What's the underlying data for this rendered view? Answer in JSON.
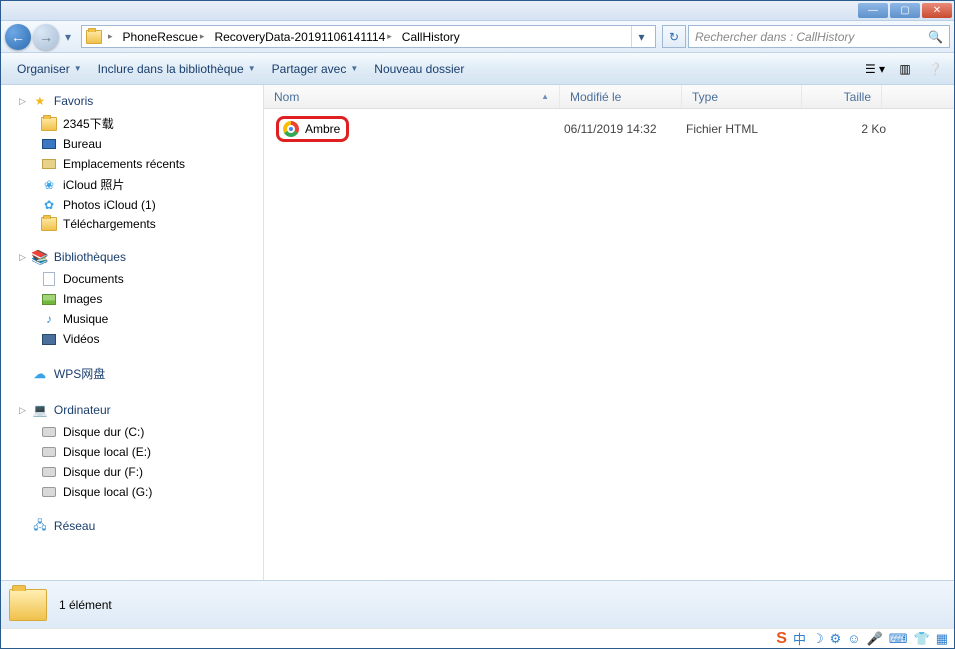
{
  "window_controls": {
    "min": "—",
    "max": "▢",
    "close": "✕"
  },
  "nav": {
    "back": "←",
    "forward": "→",
    "dropdown": "▾"
  },
  "breadcrumbs": [
    "PhoneRescue",
    "RecoveryData-20191106141114",
    "CallHistory"
  ],
  "search": {
    "placeholder": "Rechercher dans : CallHistory"
  },
  "toolbar": {
    "organize": "Organiser",
    "include": "Inclure dans la bibliothèque",
    "share": "Partager avec",
    "newfolder": "Nouveau dossier"
  },
  "columns": {
    "name": "Nom",
    "modified": "Modifié le",
    "type": "Type",
    "size": "Taille"
  },
  "sidebar": {
    "favorites": "Favoris",
    "fav_items": [
      "2345下载",
      "Bureau",
      "Emplacements récents",
      "iCloud 照片",
      "Photos iCloud (1)",
      "Téléchargements"
    ],
    "libraries": "Bibliothèques",
    "lib_items": [
      "Documents",
      "Images",
      "Musique",
      "Vidéos"
    ],
    "wps": "WPS网盘",
    "computer": "Ordinateur",
    "drives": [
      "Disque dur (C:)",
      "Disque local (E:)",
      "Disque dur (F:)",
      "Disque local (G:)"
    ],
    "network": "Réseau"
  },
  "files": [
    {
      "name": "Ambre",
      "modified": "06/11/2019 14:32",
      "type": "Fichier HTML",
      "size": "2 Ko"
    }
  ],
  "status": "1 élément",
  "tray": {
    "s": "S",
    "cn": "中",
    "moon": "☽",
    "gear": "⚙",
    "smile": "☺",
    "mic": "🎤",
    "kb": "⌨",
    "shirt": "👕",
    "grid": "▦"
  }
}
